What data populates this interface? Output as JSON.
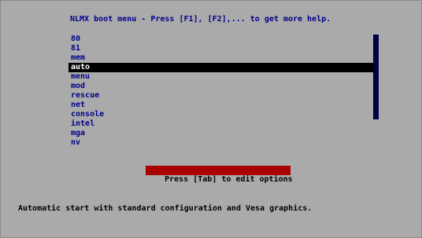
{
  "header": {
    "title": "NLMX boot menu - Press [F1], [F2],... to get more help."
  },
  "menu": {
    "items": [
      {
        "label": "80"
      },
      {
        "label": "81"
      },
      {
        "label": "mem"
      },
      {
        "label": "auto"
      },
      {
        "label": "menu"
      },
      {
        "label": "mod"
      },
      {
        "label": "rescue"
      },
      {
        "label": "net"
      },
      {
        "label": "console"
      },
      {
        "label": "intel"
      },
      {
        "label": "mga"
      },
      {
        "label": "nv"
      }
    ],
    "selected": "auto"
  },
  "hint": {
    "text": "Press [Tab] to edit options"
  },
  "footer": {
    "description": "Automatic start with standard configuration and Vesa graphics."
  },
  "colors": {
    "background": "#aaaaaa",
    "menu_text": "#000088",
    "selection_bg": "#000000",
    "selection_text": "#ffffff",
    "hint_bg": "#aa0000"
  }
}
